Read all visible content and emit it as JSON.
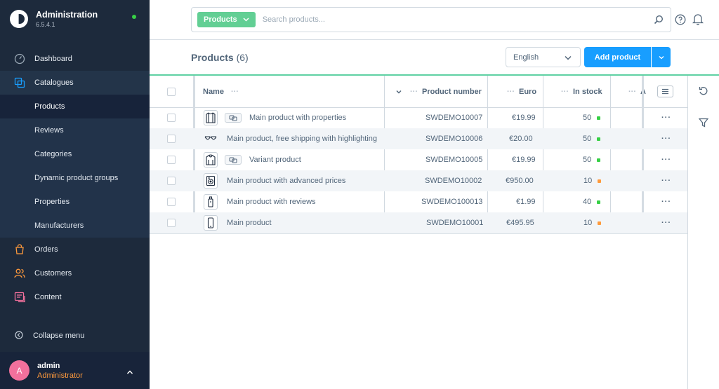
{
  "app": {
    "title": "Administration",
    "version": "6.5.4.1"
  },
  "sidebar": {
    "items": [
      {
        "label": "Dashboard",
        "icon": "dashboard-icon"
      },
      {
        "label": "Catalogues",
        "icon": "catalogue-icon"
      },
      {
        "label": "Orders",
        "icon": "orders-icon"
      },
      {
        "label": "Customers",
        "icon": "customers-icon"
      },
      {
        "label": "Content",
        "icon": "content-icon"
      }
    ],
    "sub_items": [
      "Products",
      "Reviews",
      "Categories",
      "Dynamic product groups",
      "Properties",
      "Manufacturers"
    ],
    "collapse_label": "Collapse menu"
  },
  "user": {
    "initial": "A",
    "name": "admin",
    "role": "Administrator"
  },
  "search": {
    "type_label": "Products",
    "placeholder": "Search products..."
  },
  "header": {
    "title": "Products",
    "count": "(6)",
    "language": "English",
    "add_label": "Add product"
  },
  "grid": {
    "columns": {
      "name": "Name",
      "number": "Product number",
      "price": "Euro",
      "stock": "In stock",
      "extra": "A"
    },
    "rows": [
      {
        "name": "Main product with properties",
        "number": "SWDEMO10007",
        "price": "€19.99",
        "stock": "50",
        "stock_status": "green",
        "variant": true,
        "icon": "shirt-icon"
      },
      {
        "name": "Main product, free shipping with highlighting",
        "number": "SWDEMO10006",
        "price": "€20.00",
        "stock": "50",
        "stock_status": "green",
        "variant": false,
        "icon": "sunglasses-icon"
      },
      {
        "name": "Variant product",
        "number": "SWDEMO10005",
        "price": "€19.99",
        "stock": "50",
        "stock_status": "green",
        "variant": true,
        "icon": "hoodie-icon"
      },
      {
        "name": "Main product with advanced prices",
        "number": "SWDEMO10002",
        "price": "€950.00",
        "stock": "10",
        "stock_status": "orange",
        "variant": false,
        "icon": "washing-machine-icon"
      },
      {
        "name": "Main product with reviews",
        "number": "SWDEMO100013",
        "price": "€1.99",
        "stock": "40",
        "stock_status": "green",
        "variant": false,
        "icon": "bottle-icon"
      },
      {
        "name": "Main product",
        "number": "SWDEMO10001",
        "price": "€495.95",
        "stock": "10",
        "stock_status": "orange",
        "variant": false,
        "icon": "phone-icon"
      }
    ]
  },
  "colors": {
    "sidebar": "#1d2a3c",
    "accent": "#189eff",
    "search_type": "#62cf94",
    "stock_green": "#37d046",
    "stock_orange": "#ff9a3c",
    "highlight_line": "#5fd1a3"
  }
}
